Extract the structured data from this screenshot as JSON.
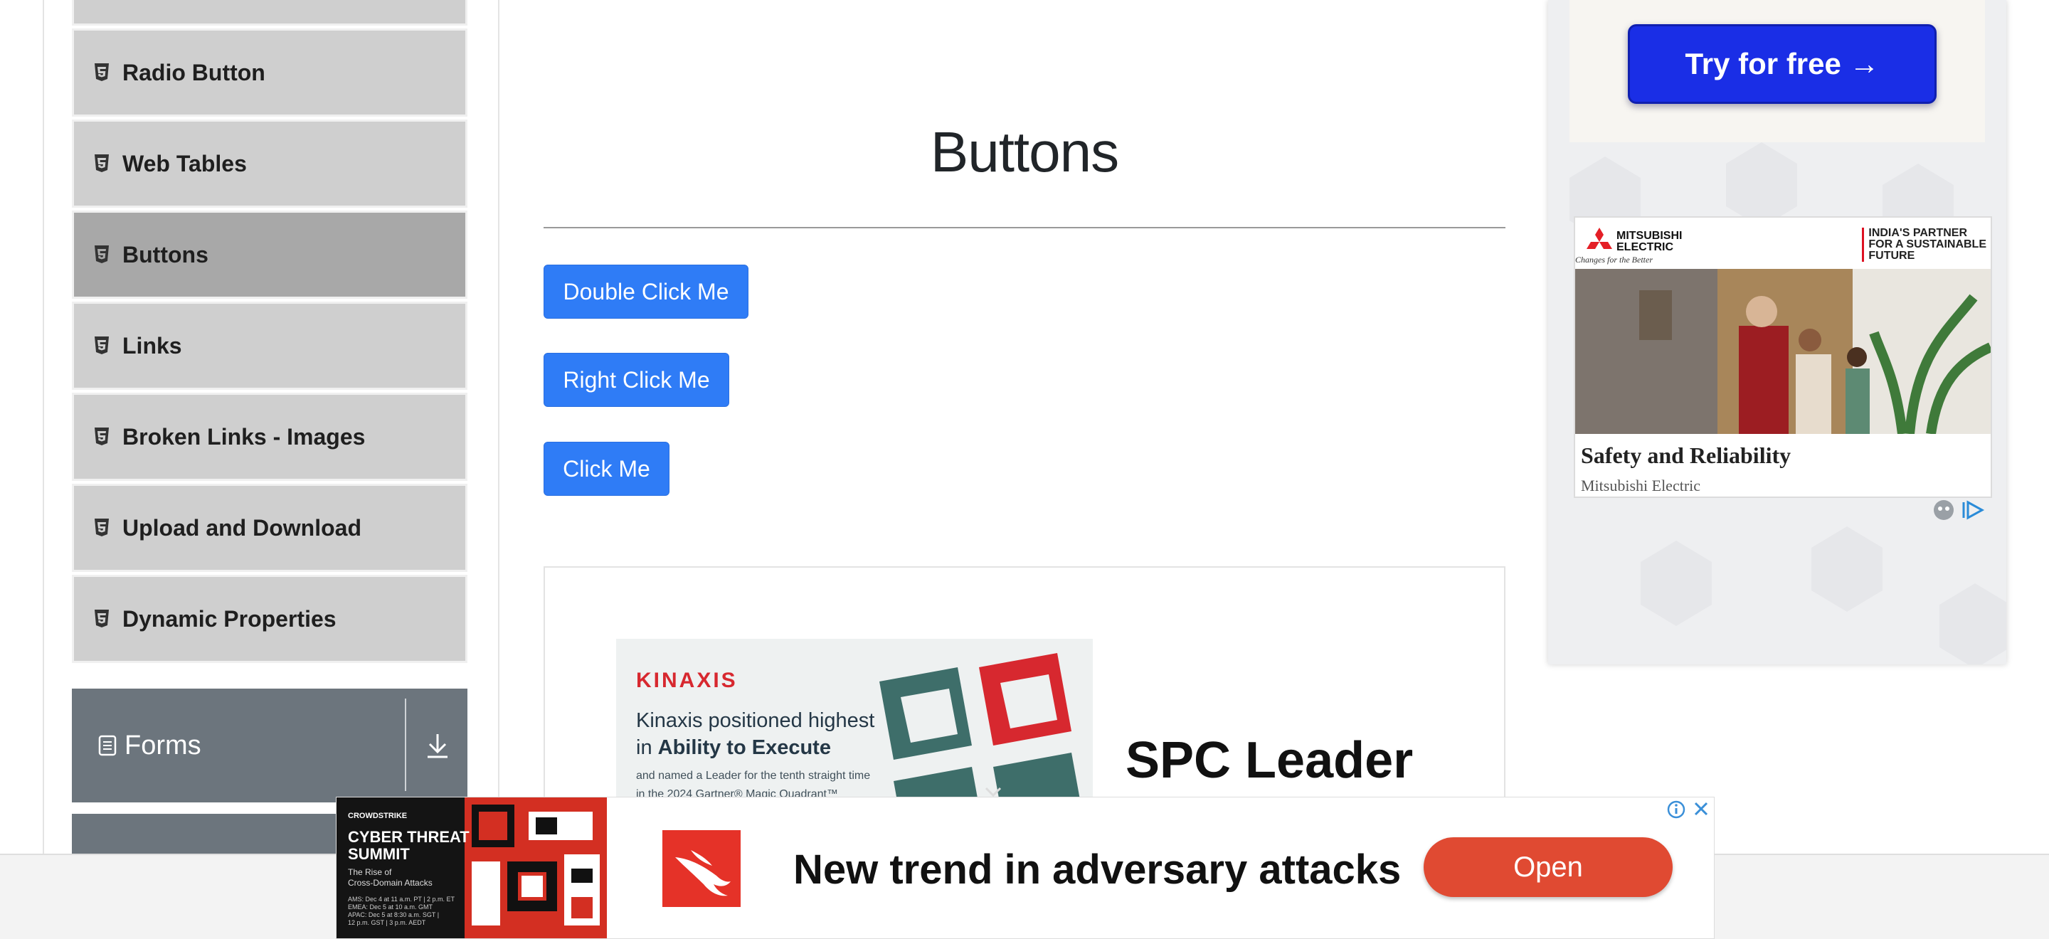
{
  "sidebar": {
    "items": [
      {
        "label": "Radio Button",
        "active": false
      },
      {
        "label": "Web Tables",
        "active": false
      },
      {
        "label": "Buttons",
        "active": true
      },
      {
        "label": "Links",
        "active": false
      },
      {
        "label": "Broken Links - Images",
        "active": false
      },
      {
        "label": "Upload and Download",
        "active": false
      },
      {
        "label": "Dynamic Properties",
        "active": false
      }
    ],
    "group": {
      "title": "Forms",
      "icon": "document-icon",
      "toggle_icon": "download-arrow-icon"
    }
  },
  "main": {
    "title": "Buttons",
    "buttons": {
      "double_click": "Double Click Me",
      "right_click": "Right Click Me",
      "click": "Click Me"
    },
    "accent_color": "#2f7cf6"
  },
  "content_ad": {
    "brand": "KINAXIS",
    "headline_1": "Kinaxis positioned highest",
    "headline_2_pre": "in ",
    "headline_2_bold": "Ability to Execute",
    "small_1": "and named a Leader for the tenth straight time",
    "small_2": "in the 2024 Gartner® Magic Quadrant™",
    "side_text": "SPC Leader"
  },
  "right_ad": {
    "cta": "Try for free →",
    "brand_line_1": "MITSUBISHI",
    "brand_line_2": "ELECTRIC",
    "brand_tagline": "Changes for the Better",
    "partner_line_1": "INDIA'S PARTNER",
    "partner_line_2": "FOR A SUSTAINABLE",
    "partner_line_3": "FUTURE",
    "title": "Safety and Reliability",
    "advertiser": "Mitsubishi Electric"
  },
  "bottom_ad": {
    "brand": "CROWDSTRIKE",
    "event_line_1": "CYBER THREAT",
    "event_line_2": "SUMMIT",
    "event_sub_1": "The Rise of",
    "event_sub_2": "Cross-Domain Attacks",
    "dates_1": "AMS: Dec 4 at 11 a.m. PT | 2 p.m. ET",
    "dates_2": "EMEA: Dec 5 at 10 a.m. GMT",
    "dates_3": "APAC: Dec 5 at 8:30 a.m. SGT |",
    "dates_4": "12 p.m. GST | 3 p.m. AEDT",
    "headline": "New trend in adversary attacks",
    "cta": "Open",
    "cta_color": "#e04a32"
  }
}
